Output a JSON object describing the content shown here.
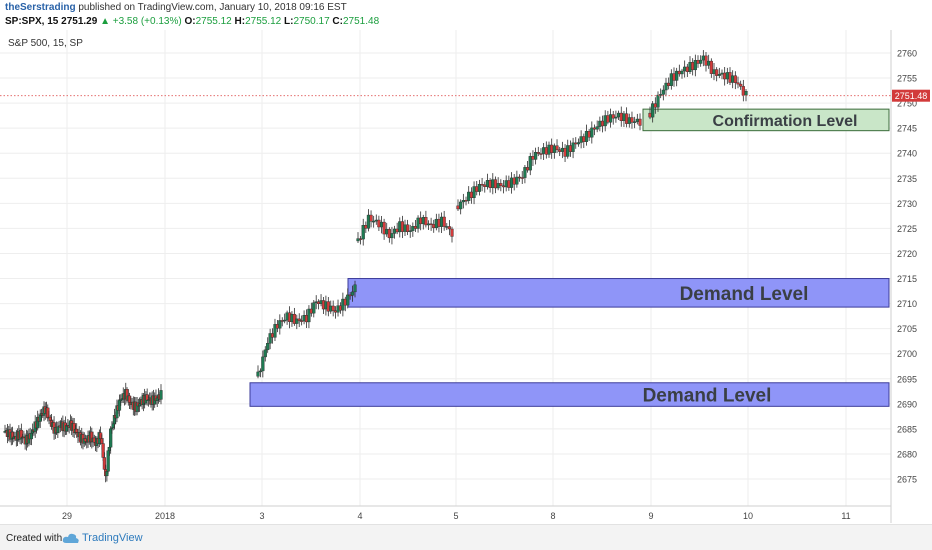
{
  "header": {
    "author": "theSerstrading",
    "published": "published on TradingView.com, January 10, 2018 09:16 EST",
    "symbol": "SP:SPX, 15",
    "last": "2751.29",
    "change": "▲ +3.58 (+0.13%)",
    "o_label": "O:",
    "o_value": "2755.12",
    "h_label": "H:",
    "h_value": "2755.12",
    "l_label": "L:",
    "l_value": "2750.17",
    "c_label": "C:",
    "c_value": "2751.48"
  },
  "footer": {
    "created": "Created with",
    "brand": "TradingView"
  },
  "colors": {
    "up": "#1f7a52",
    "down": "#d33b3b",
    "demand_fill": "#8f95f8",
    "demand_border": "#3b3b9a",
    "confirm_fill": "#c9e6c8",
    "confirm_border": "#3b6b3b",
    "price_line": "#e05a5a",
    "grid": "#eeeeee"
  },
  "chart_data": {
    "type": "candlestick",
    "title": "S&P 500, 15, SP",
    "ylim": [
      2670,
      2762
    ],
    "y_ticks": [
      2675,
      2680,
      2685,
      2690,
      2695,
      2700,
      2705,
      2710,
      2715,
      2720,
      2725,
      2730,
      2735,
      2740,
      2745,
      2750,
      2755,
      2760
    ],
    "x_ticks": [
      "29",
      "2018",
      "3",
      "4",
      "5",
      "8",
      "9",
      "10",
      "11"
    ],
    "last_price": "2751.48",
    "zones": [
      {
        "label": "Confirmation Level",
        "kind": "confirmation",
        "low": 2744.5,
        "high": 2748.8
      },
      {
        "label": "Demand Level",
        "kind": "demand",
        "low": 2709.3,
        "high": 2715.0
      },
      {
        "label": "Demand Level",
        "kind": "demand",
        "low": 2689.5,
        "high": 2694.2
      }
    ],
    "session_paths": [
      [
        2684.5,
        2683.8,
        2683.2,
        2684.0,
        2682.6,
        2683.5,
        2685.6,
        2687.5,
        2689.0,
        2686.5,
        2684.5,
        2685.8,
        2685.2,
        2685.9,
        2684.6,
        2683.2,
        2682.5,
        2683.5,
        2682.0,
        2683.8,
        2675.0,
        2684.5,
        2688.0,
        2691.0,
        2692.0,
        2690.0,
        2689.3,
        2690.4,
        2691.2,
        2690.6,
        2691.0,
        2691.8
      ],
      [
        2695.5,
        2702.5,
        2705.8,
        2707.5,
        2706.5,
        2707.2,
        2710.5,
        2709.5,
        2708.5,
        2710.5,
        2713.2
      ],
      [
        2722.5,
        2727.0,
        2726.0,
        2723.5,
        2725.5,
        2724.5,
        2726.8,
        2725.5,
        2726.5,
        2724.0
      ],
      [
        2729.5,
        2731.5,
        2733.5,
        2734.0,
        2733.5,
        2734.2,
        2735.5,
        2739.5,
        2740.5,
        2741.0,
        2740.2,
        2742.0,
        2743.5,
        2745.5,
        2747.0,
        2747.5,
        2746.5,
        2746.3
      ],
      [
        2748.0,
        2752.0,
        2755.0,
        2756.5,
        2757.5,
        2759.0,
        2756.0,
        2755.5,
        2754.5,
        2751.5
      ]
    ]
  }
}
